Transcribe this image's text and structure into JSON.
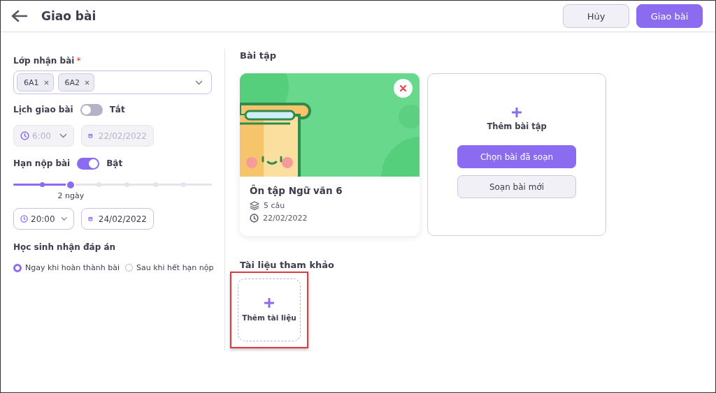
{
  "header": {
    "title": "Giao bài",
    "buttons": [
      {
        "label": "Hủy",
        "kind": "secondary"
      },
      {
        "label": "Giao bài",
        "kind": "primary"
      }
    ]
  },
  "settings": {
    "class_field": {
      "label": "Lớp nhận bài",
      "required_mark": "*",
      "chips": [
        "6A1",
        "6A2"
      ]
    },
    "schedule": {
      "label": "Lịch giao bài",
      "on": false,
      "state_label": "Tắt",
      "time": "6:00",
      "date": "22/02/2022",
      "disabled": true
    },
    "deadline": {
      "label": "Hạn nộp bài",
      "on": true,
      "state_label": "Bật",
      "level": 0.29,
      "slider_reading": "2 ngày",
      "time": "20:00",
      "date": "24/02/2022",
      "disabled": false
    },
    "answers": {
      "label": "Học sinh nhận đáp án",
      "options": [
        {
          "label": "Ngay khi hoàn thành bài",
          "selected": true
        },
        {
          "label": "Sau khi hết hạn nộp",
          "selected": false
        }
      ]
    }
  },
  "exercises": {
    "heading": "Bài tập",
    "items": [
      {
        "title": "Ôn tập Ngữ văn 6",
        "questions": "5 câu",
        "date": "22/02/2022"
      }
    ],
    "add_card": {
      "label": "Thêm bài tập",
      "buttons": [
        {
          "label": "Chọn bài đã soạn",
          "kind": "primary"
        },
        {
          "label": "Soạn bài mới",
          "kind": "secondary"
        }
      ]
    }
  },
  "materials": {
    "heading": "Tài liệu tham khảo",
    "add_tile": {
      "label": "Thêm tài liệu",
      "highlighted": true
    }
  }
}
